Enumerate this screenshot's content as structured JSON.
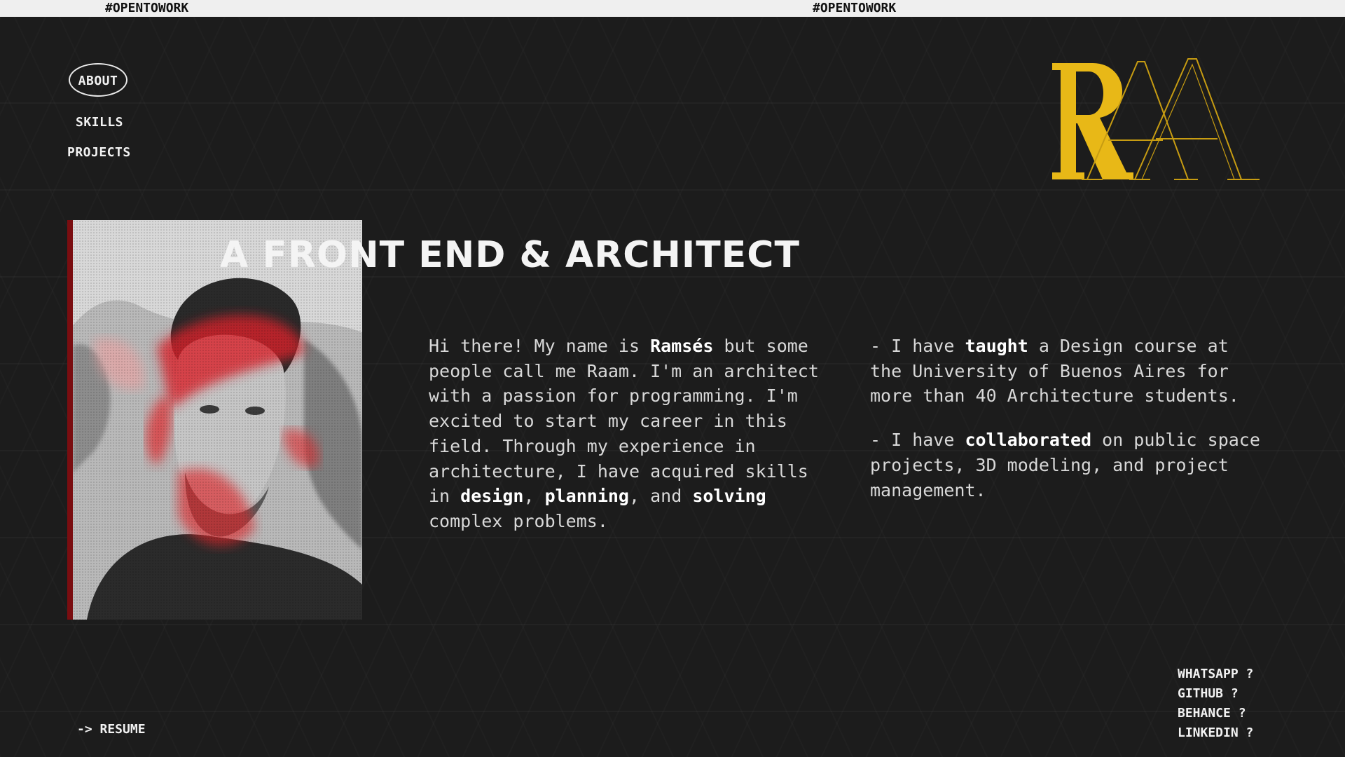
{
  "ticker": {
    "left_text": "#OPENTOWORK",
    "right_text": "#OPENTOWORK"
  },
  "nav": {
    "about": "ABOUT",
    "skills": "SKILLS",
    "projects": "PROJECTS"
  },
  "logo": {
    "text": "RAA",
    "fill_color": "#e8b817"
  },
  "colors": {
    "accent": "#e8b817",
    "photo_border": "#7a0d10",
    "background": "#1c1c1c"
  },
  "hero": {
    "headline": "A FRONT END & ARCHITECT"
  },
  "about_left": {
    "p1_a": "Hi there! My name is ",
    "p1_b": "Ramsés",
    "p1_c": " but some people call me Raam. I'm an architect with a passion for programming. I'm excited to start my career in this field. Through my experience in architecture, I have acquired skills in ",
    "p1_d": "design",
    "p1_e": ", ",
    "p1_f": "planning",
    "p1_g": ", and ",
    "p1_h": "solving",
    "p1_i": " complex problems."
  },
  "about_right": {
    "p1_a": "- I have ",
    "p1_b": "taught",
    "p1_c": " a Design course at the University of Buenos Aires for more than 40 Architecture students.",
    "p2_a": "- I have ",
    "p2_b": "collaborated",
    "p2_c": " on public space projects, 3D modeling, and project management."
  },
  "social": {
    "whatsapp": "WHATSAPP ?",
    "github": "GITHUB ?",
    "behance": "BEHANCE ?",
    "linkedin": "LINKEDIN ?"
  },
  "resume": "-> RESUME"
}
